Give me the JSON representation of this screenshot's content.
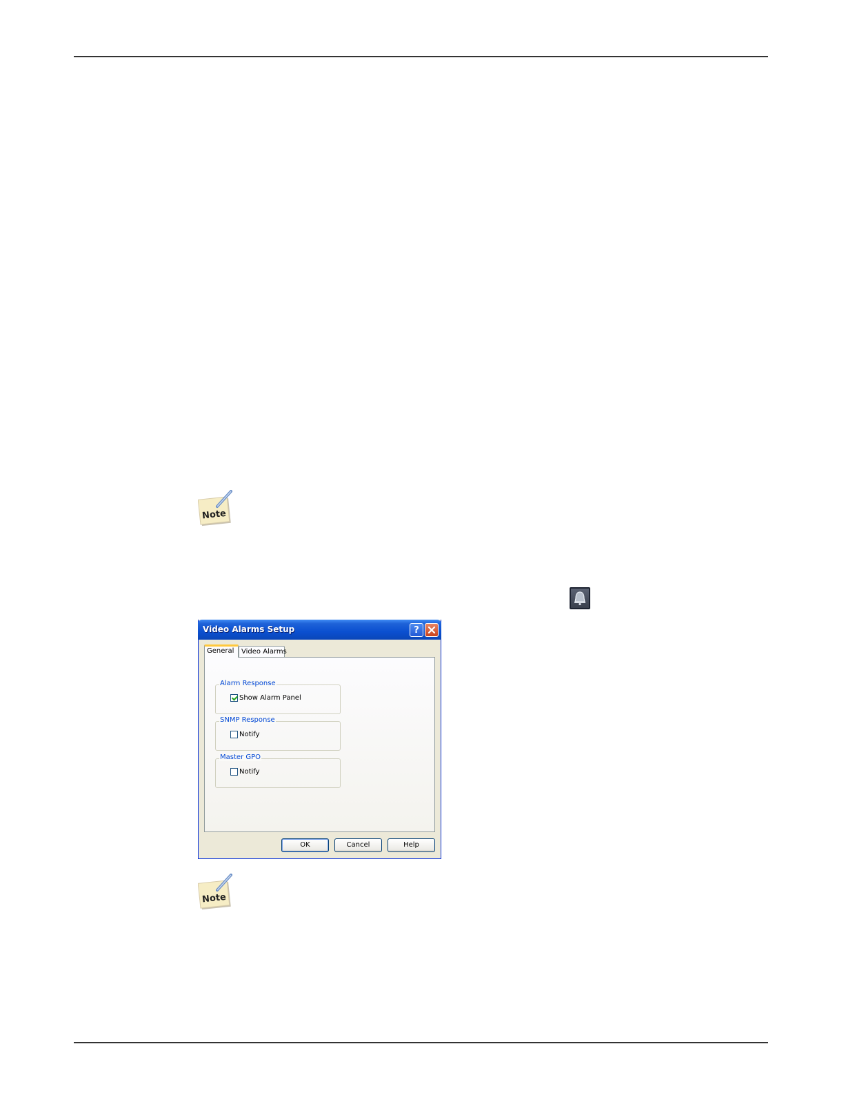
{
  "dialog": {
    "title": "Video Alarms Setup",
    "help_glyph": "?",
    "tabs": [
      {
        "label": "General",
        "active": true
      },
      {
        "label": "Video Alarms",
        "active": false
      }
    ],
    "groups": [
      {
        "title": "Alarm Response",
        "checkbox_label": "Show Alarm Panel",
        "checked": true
      },
      {
        "title": "SNMP Response",
        "checkbox_label": "Notify",
        "checked": false
      },
      {
        "title": "Master GPO",
        "checkbox_label": "Notify",
        "checked": false
      }
    ],
    "buttons": {
      "ok": "OK",
      "cancel": "Cancel",
      "help": "Help"
    }
  },
  "note_icon_text": "Note",
  "icons": {
    "note": "note-icon",
    "bell": "bell-icon",
    "close": "close-icon",
    "help": "help-icon"
  },
  "colors": {
    "titlebar": "#0b50d0",
    "group_title": "#0046d5",
    "tab_highlight": "#ffc83c",
    "check_mark": "#21a121"
  }
}
